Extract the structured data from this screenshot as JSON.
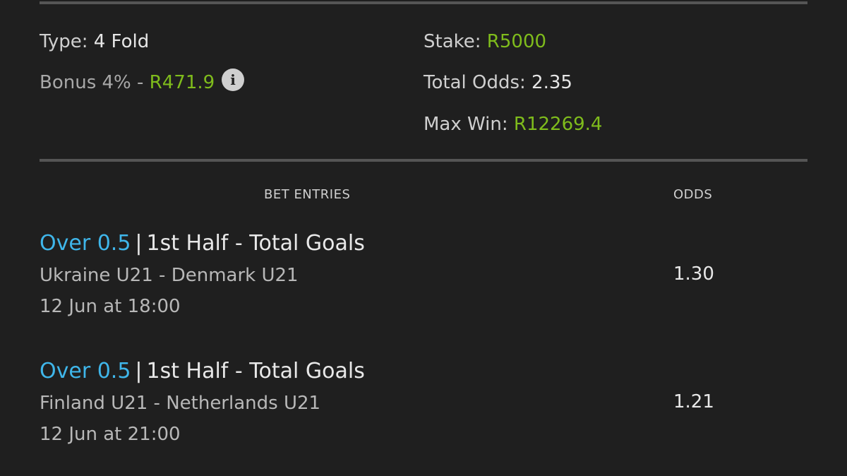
{
  "summary": {
    "type_label": "Type:",
    "type_value": "4 Fold",
    "bonus_label": "Bonus 4% -",
    "bonus_value": "R471.9",
    "stake_label": "Stake:",
    "stake_value": "R5000",
    "total_odds_label": "Total Odds:",
    "total_odds_value": "2.35",
    "max_win_label": "Max Win:",
    "max_win_value": "R12269.4",
    "info_icon": "info-icon"
  },
  "headers": {
    "bet_entries": "BET ENTRIES",
    "odds": "ODDS"
  },
  "entries": [
    {
      "selection": "Over 0.5",
      "separator": "|",
      "market": "1st Half - Total Goals",
      "match": "Ukraine U21 - Denmark U21",
      "time": "12 Jun at 18:00",
      "odds": "1.30"
    },
    {
      "selection": "Over 0.5",
      "separator": "|",
      "market": "1st Half - Total Goals",
      "match": "Finland U21 - Netherlands U21",
      "time": "12 Jun at 21:00",
      "odds": "1.21"
    }
  ],
  "colors": {
    "background": "#1f1f1f",
    "accent_green": "#7fbc1c",
    "accent_blue": "#3fb6ea",
    "divider": "#555555"
  }
}
